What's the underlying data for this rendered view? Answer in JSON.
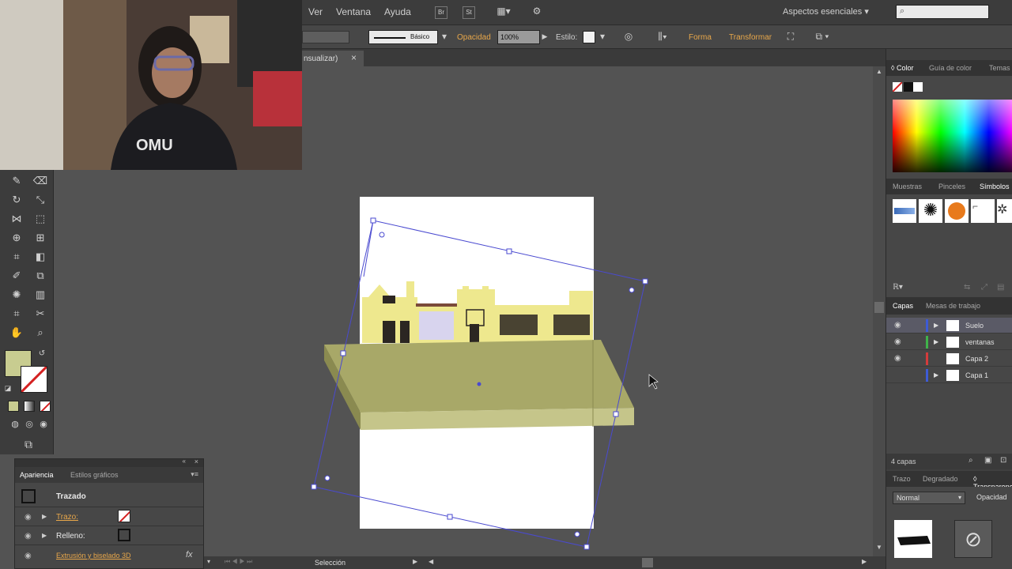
{
  "menubar": {
    "items": [
      "Ver",
      "Ventana",
      "Ayuda"
    ],
    "workspace": "Aspectos esenciales",
    "search_placeholder": ""
  },
  "controlbar": {
    "stroke_profile": "Básico",
    "opacity_label": "Opacidad",
    "opacity_value": "100%",
    "style_label": "Estilo:",
    "forma": "Forma",
    "transformar": "Transformar"
  },
  "document": {
    "tab_title": "nsualizar)",
    "close_glyph": "×"
  },
  "appearance_panel": {
    "tabs": [
      "Apariencia",
      "Estilos gráficos"
    ],
    "object_type": "Trazado",
    "rows": [
      {
        "label": "Trazo:",
        "link": true
      },
      {
        "label": "Relleno:",
        "link": false
      },
      {
        "label": "Extrusión y biselado 3D",
        "link": true
      }
    ],
    "fx": "fx"
  },
  "right_panels": {
    "color_tabs": [
      "Color",
      "Guía de color",
      "Temas"
    ],
    "swatch_tabs": [
      "Muestras",
      "Pinceles",
      "Símbolos"
    ],
    "layers_tabs": [
      "Capas",
      "Mesas de trabajo"
    ],
    "layers": [
      {
        "name": "Suelo",
        "color": "#3d5bd6",
        "expandable": true,
        "selected": true
      },
      {
        "name": "ventanas",
        "color": "#3fb34a",
        "expandable": true,
        "selected": false
      },
      {
        "name": "Capa 2",
        "color": "#d43b3b",
        "expandable": false,
        "selected": false
      },
      {
        "name": "Capa 1",
        "color": "#3d5bd6",
        "expandable": true,
        "selected": false
      }
    ],
    "layer_count": "4 capas",
    "transparency_tabs": [
      "Trazo",
      "Degradado",
      "Transparencia"
    ],
    "blend_mode": "Normal",
    "opacity_label": "Opacidad"
  },
  "statusbar": {
    "mode": "Selección"
  },
  "colors": {
    "fill_swatch": "#c8cc90",
    "selection": "#4a4ad0",
    "platform_top": "#a8a868",
    "platform_front": "#c5c58a",
    "building": "#eee88e",
    "accent": "#e8a74a"
  }
}
